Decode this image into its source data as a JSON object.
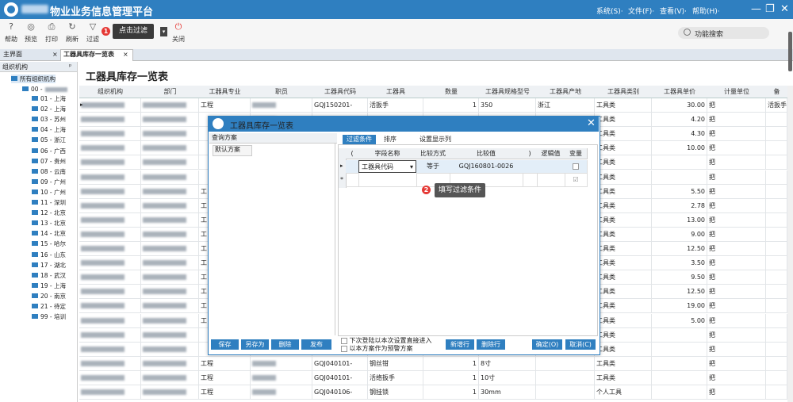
{
  "app": {
    "title": "物业业务信息管理平台",
    "menus": [
      "系统(S)·",
      "文件(F)·",
      "查看(V)·",
      "帮助(H)·"
    ]
  },
  "toolbar": {
    "buttons": [
      {
        "label": "帮助",
        "icon": "help-icon"
      },
      {
        "label": "预览",
        "icon": "preview-icon"
      },
      {
        "label": "打印",
        "icon": "print-icon"
      },
      {
        "label": "刷新",
        "icon": "refresh-icon"
      },
      {
        "label": "过滤",
        "icon": "filter-icon"
      },
      {
        "label": "关闭",
        "icon": "power-icon"
      }
    ],
    "tooltip": "点击过滤",
    "tooltip_badge": "1",
    "search_label": "功能搜索"
  },
  "tabs": [
    {
      "label": "主界面",
      "close": "×"
    },
    {
      "label": "工器具库存一览表",
      "close": "×"
    }
  ],
  "tree": {
    "header": "组织机构",
    "pin": "ᵖ",
    "root": "所有组织机构",
    "sub_root": "00 -",
    "items": [
      "01 - 上海",
      "02 - 上海",
      "03 - 苏州",
      "04 - 上海",
      "05 - 浙江",
      "06 - 广西",
      "07 - 贵州",
      "08 - 云南",
      "09 - 广州",
      "10 - 广州",
      "11 - 深圳",
      "12 - 北京",
      "13 - 北京",
      "14 - 北京",
      "15 - 哈尔",
      "16 - 山东",
      "17 - 湖北",
      "18 - 武汉",
      "19 - 上海",
      "20 - 南京",
      "21 - 待定",
      "99 - 培训"
    ]
  },
  "main": {
    "title": "工器具库存一览表",
    "columns": [
      "组织机构",
      "部门",
      "工器具专业",
      "职员",
      "工器具代码",
      "工器具",
      "数量",
      "工器具规格型号",
      "工器具产地",
      "工器具类别",
      "工器具单价",
      "计量单位",
      "备"
    ],
    "rows": [
      {
        "spec": "工程",
        "code": "GQJ150201-",
        "tool": "活扳手",
        "qty": "1",
        "model": "350",
        "origin": "浙江",
        "cat": "工具类",
        "price": "30.00",
        "unit": "把",
        "note": "活扳手"
      },
      {
        "spec": "",
        "code": "",
        "tool": "",
        "qty": "",
        "model": "",
        "origin": "",
        "cat": "工具类",
        "price": "4.20",
        "unit": "把",
        "note": ""
      },
      {
        "spec": "",
        "code": "",
        "tool": "",
        "qty": "",
        "model": "",
        "origin": "",
        "cat": "工具类",
        "price": "4.30",
        "unit": "把",
        "note": ""
      },
      {
        "spec": "",
        "code": "",
        "tool": "",
        "qty": "",
        "model": "",
        "origin": "",
        "cat": "工具类",
        "price": "10.00",
        "unit": "把",
        "note": ""
      },
      {
        "spec": "",
        "code": "",
        "tool": "",
        "qty": "",
        "model": "",
        "origin": "",
        "cat": "工具类",
        "price": "",
        "unit": "把",
        "note": ""
      },
      {
        "spec": "",
        "code": "",
        "tool": "",
        "qty": "",
        "model": "",
        "origin": "",
        "cat": "工具类",
        "price": "",
        "unit": "把",
        "note": ""
      },
      {
        "spec": "工",
        "code": "",
        "tool": "",
        "qty": "",
        "model": "",
        "origin": "",
        "cat": "工具类",
        "price": "5.50",
        "unit": "把",
        "note": ""
      },
      {
        "spec": "工",
        "code": "",
        "tool": "",
        "qty": "",
        "model": "",
        "origin": "",
        "cat": "工具类",
        "price": "2.78",
        "unit": "把",
        "note": ""
      },
      {
        "spec": "工",
        "code": "",
        "tool": "",
        "qty": "",
        "model": "",
        "origin": "",
        "cat": "工具类",
        "price": "13.00",
        "unit": "把",
        "note": ""
      },
      {
        "spec": "工",
        "code": "",
        "tool": "",
        "qty": "",
        "model": "",
        "origin": "",
        "cat": "工具类",
        "price": "9.00",
        "unit": "把",
        "note": ""
      },
      {
        "spec": "工",
        "code": "",
        "tool": "",
        "qty": "",
        "model": "",
        "origin": "",
        "cat": "工具类",
        "price": "12.50",
        "unit": "把",
        "note": ""
      },
      {
        "spec": "工",
        "code": "",
        "tool": "",
        "qty": "",
        "model": "",
        "origin": "",
        "cat": "工具类",
        "price": "3.50",
        "unit": "把",
        "note": ""
      },
      {
        "spec": "工",
        "code": "",
        "tool": "",
        "qty": "",
        "model": "",
        "origin": "",
        "cat": "工具类",
        "price": "9.50",
        "unit": "把",
        "note": ""
      },
      {
        "spec": "工",
        "code": "",
        "tool": "",
        "qty": "",
        "model": "",
        "origin": "",
        "cat": "工具类",
        "price": "12.50",
        "unit": "把",
        "note": ""
      },
      {
        "spec": "工",
        "code": "",
        "tool": "",
        "qty": "",
        "model": "",
        "origin": "",
        "cat": "工具类",
        "price": "19.00",
        "unit": "把",
        "note": ""
      },
      {
        "spec": "工",
        "code": "",
        "tool": "",
        "qty": "",
        "model": "",
        "origin": "",
        "cat": "工具类",
        "price": "5.00",
        "unit": "把",
        "note": ""
      },
      {
        "spec": "",
        "code": "",
        "tool": "",
        "qty": "",
        "model": "",
        "origin": "",
        "cat": "工具类",
        "price": "",
        "unit": "把",
        "note": ""
      },
      {
        "spec": "",
        "code": "",
        "tool": "",
        "qty": "",
        "model": "",
        "origin": "",
        "cat": "工具类",
        "price": "",
        "unit": "把",
        "note": ""
      },
      {
        "spec": "工程",
        "code": "GQJ040101-",
        "tool": "钢丝钳",
        "qty": "1",
        "model": "8寸",
        "origin": "",
        "cat": "工具类",
        "price": "",
        "unit": "把",
        "note": ""
      },
      {
        "spec": "工程",
        "code": "GQJ040101-",
        "tool": "活络扳手",
        "qty": "1",
        "model": "10寸",
        "origin": "",
        "cat": "工具类",
        "price": "",
        "unit": "把",
        "note": ""
      },
      {
        "spec": "工程",
        "code": "GQJ040106-",
        "tool": "钢挂锁",
        "qty": "1",
        "model": "30mm",
        "origin": "",
        "cat": "个人工具",
        "price": "",
        "unit": "把",
        "note": ""
      }
    ]
  },
  "dialog": {
    "title": "工器具库存一览表",
    "close": "✕",
    "scheme_header": "查询方案",
    "scheme_item": "默认方案",
    "tabs": [
      "过滤条件",
      "排序",
      "设置显示列"
    ],
    "filter_columns": [
      "(",
      "字段名称",
      "比较方式",
      "比较值",
      ")",
      "逻辑值",
      "变量"
    ],
    "filter_row": {
      "field": "工器具代码",
      "compare": "等于",
      "value": "GQJ160801-0026"
    },
    "tooltip": "填写过滤条件",
    "tooltip_badge": "2",
    "buttons_left": [
      "保存",
      "另存为",
      "删除",
      "发布"
    ],
    "checkbox1": "下次登陆以本次设置直接进入",
    "checkbox2": "以本方案作为预警方案",
    "buttons_mid": [
      "新增行",
      "删除行"
    ],
    "buttons_right": [
      "确定(O)",
      "取消(C)"
    ]
  }
}
